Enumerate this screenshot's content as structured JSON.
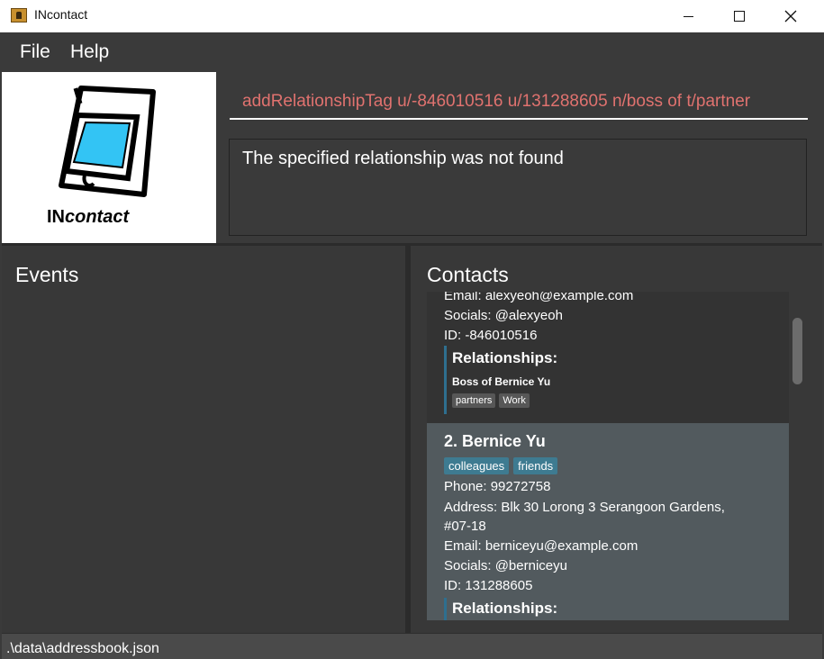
{
  "window": {
    "title": "INcontact",
    "icon": "address-book-icon"
  },
  "menu": {
    "items": [
      "File",
      "Help"
    ]
  },
  "logo": {
    "text_prefix": "IN",
    "text_suffix": "contact",
    "icon": "phone-icon"
  },
  "command": {
    "value": "addRelationshipTag u/-846010516 u/131288605 n/boss of t/partner"
  },
  "result": {
    "message": "The specified relationship was not found"
  },
  "events": {
    "title": "Events"
  },
  "contacts": {
    "title": "Contacts",
    "cards": [
      {
        "email": "Email: alexyeoh@example.com",
        "socials": "Socials: @alexyeoh",
        "id": "ID: -846010516",
        "relationships_title": "Relationships:",
        "relationship": "Boss of  Bernice Yu",
        "relationship_tags": [
          "partners",
          "Work"
        ]
      },
      {
        "name": "2. Bernice Yu",
        "tags": [
          "colleagues",
          "friends"
        ],
        "phone": "Phone: 99272758",
        "address_line1": "Address: Blk 30 Lorong 3 Serangoon Gardens,",
        "address_line2": "#07-18",
        "email": "Email: berniceyu@example.com",
        "socials": "Socials: @berniceyu",
        "id": "ID: 131288605",
        "relationships_title": "Relationships:"
      }
    ]
  },
  "status": {
    "path": ".\\data\\addressbook.json"
  },
  "colors": {
    "background": "#3a3a3a",
    "command_text": "#e0726f",
    "tag": "#3e7b91",
    "selected_card": "#525a5e"
  }
}
